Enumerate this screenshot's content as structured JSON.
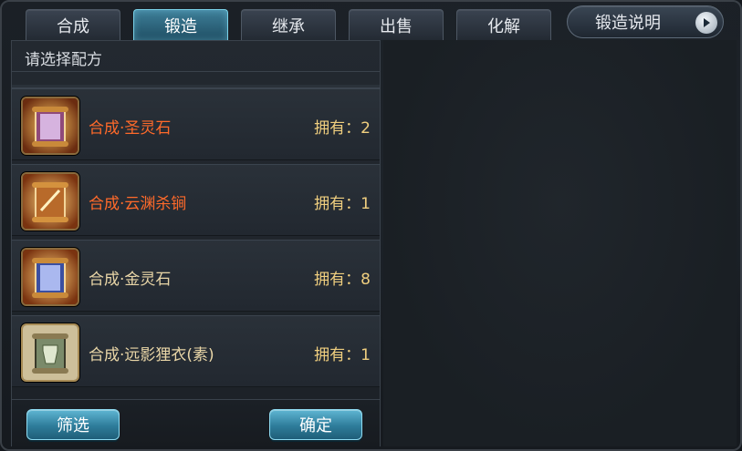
{
  "tabs": [
    {
      "label": "合成"
    },
    {
      "label": "锻造",
      "active": true
    },
    {
      "label": "继承"
    },
    {
      "label": "出售"
    },
    {
      "label": "化解"
    }
  ],
  "help_button": {
    "label": "锻造说明",
    "icon": "play-arrow-icon"
  },
  "panel": {
    "title": "请选择配方"
  },
  "recipes": [
    {
      "name": "合成·圣灵石",
      "count": "拥有：2",
      "color": "#ff6a2a",
      "icon": "scroll-purple-icon"
    },
    {
      "name": "合成·云渊杀锏",
      "count": "拥有：1",
      "color": "#ff6a2a",
      "icon": "scroll-orange-icon"
    },
    {
      "name": "合成·金灵石",
      "count": "拥有：8",
      "color": "#e9d6a7",
      "icon": "scroll-blue-icon"
    },
    {
      "name": "合成·远影狸衣(素)",
      "count": "拥有：1",
      "color": "#e9d6a7",
      "icon": "scroll-green-icon"
    }
  ],
  "buttons": {
    "filter": "筛选",
    "confirm": "确定"
  },
  "colors": {
    "accent": "#3e7f99",
    "highlight_text": "#ff6a2a",
    "count_text": "#f0cf7f"
  }
}
